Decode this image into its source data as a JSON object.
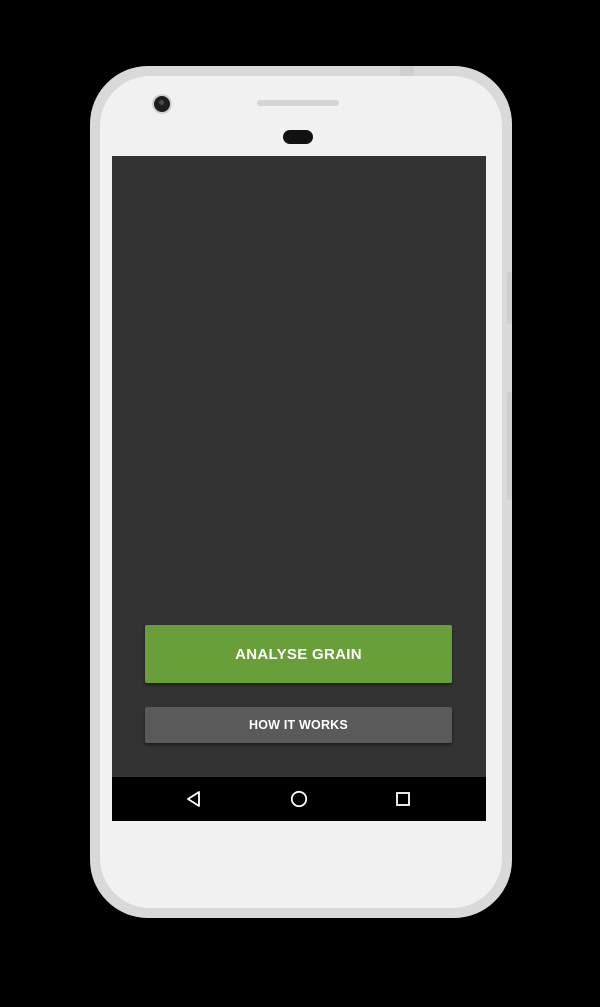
{
  "device": {
    "frame_color": "#f1f1f1",
    "screen_bg": "#333333",
    "navbar_bg": "#000000"
  },
  "actions": {
    "analyse_label": "ANALYSE GRAIN",
    "analyse_color": "#689f38",
    "how_label": "HOW IT WORKS",
    "how_color": "#5a5a5a"
  },
  "navbar": {
    "back_icon": "back-triangle-icon",
    "home_icon": "home-circle-icon",
    "recents_icon": "recents-square-icon"
  }
}
